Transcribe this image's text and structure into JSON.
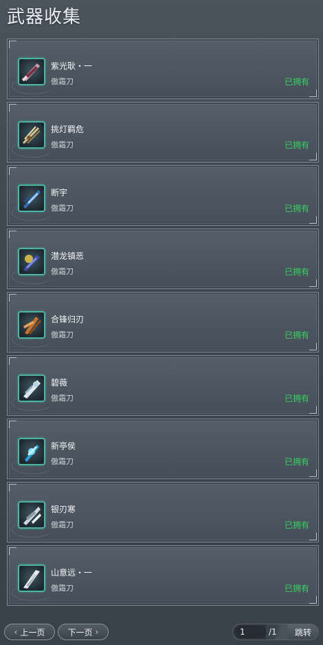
{
  "title": "武器收集",
  "weapons": [
    {
      "name": "紫光耿・一",
      "type": "傲霜刀",
      "status": "已拥有",
      "icon": "weapon-purple-blade-icon"
    },
    {
      "name": "挑灯羁危",
      "type": "傲霜刀",
      "status": "已拥有",
      "icon": "weapon-golden-trident-icon"
    },
    {
      "name": "断宇",
      "type": "傲霜刀",
      "status": "已拥有",
      "icon": "weapon-blue-blade-icon"
    },
    {
      "name": "潜龙镇恶",
      "type": "傲霜刀",
      "status": "已拥有",
      "icon": "weapon-dragon-blade-icon"
    },
    {
      "name": "合锋归刃",
      "type": "傲霜刀",
      "status": "已拥有",
      "icon": "weapon-orange-blade-icon"
    },
    {
      "name": "碧薇",
      "type": "傲霜刀",
      "status": "已拥有",
      "icon": "weapon-white-blade-icon"
    },
    {
      "name": "新亭侯",
      "type": "傲霜刀",
      "status": "已拥有",
      "icon": "weapon-cyan-blade-icon"
    },
    {
      "name": "银刃寒",
      "type": "傲霜刀",
      "status": "已拥有",
      "icon": "weapon-silver-blade-icon"
    },
    {
      "name": "山意远・一",
      "type": "傲霜刀",
      "status": "已拥有",
      "icon": "weapon-mountain-blade-icon"
    }
  ],
  "pagination": {
    "prev_label": "上一页",
    "next_label": "下一页",
    "current_page": "1",
    "total_pages": "/1",
    "jump_label": "跳转"
  },
  "colors": {
    "owned": "#37d060",
    "icon_border": "#4fb3a6"
  }
}
